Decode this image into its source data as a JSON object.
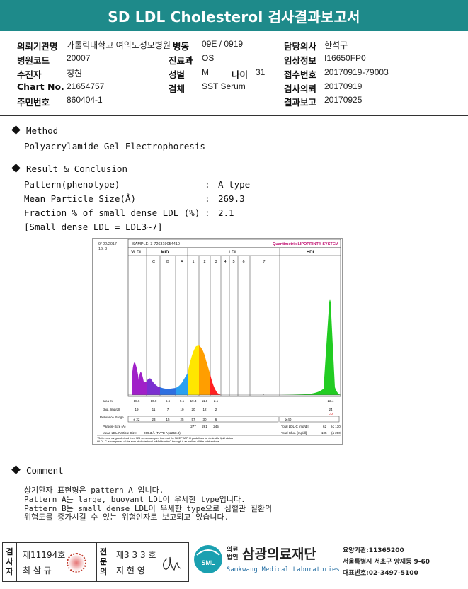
{
  "header": {
    "title": "SD LDL Cholesterol 검사결과보고서"
  },
  "patient_info": {
    "institution_label": "의뢰기관명",
    "institution": "가톨릭대학교 여의도성모병원",
    "ward_label": "병동",
    "ward": "09E / 0919",
    "doctor_label": "담당의사",
    "doctor": "한석구",
    "hospital_code_label": "병원코드",
    "hospital_code": "20007",
    "dept_label": "진료과",
    "dept": "OS",
    "clinical_label": "임상정보",
    "clinical": "I16650FP0",
    "recipient_label": "수진자",
    "recipient": "정현",
    "sex_label": "성별",
    "sex": "M",
    "age_label": "나이",
    "age": "31",
    "receipt_label": "접수번호",
    "receipt": "20170919-79003",
    "chart_label": "Chart No.",
    "chart": "21654757",
    "specimen_label": "검체",
    "specimen": "SST Serum",
    "request_label": "검사의뢰",
    "request": "20170919",
    "rrn_label": "주민번호",
    "rrn": "860404-1",
    "report_label": "결과보고",
    "report": "20170925"
  },
  "method": {
    "heading": "Method",
    "text": "Polyacrylamide Gel Electrophoresis"
  },
  "result": {
    "heading": "Result & Conclusion",
    "pattern_label": "Pattern(phenotype)",
    "pattern_value": "A type",
    "size_label": "Mean Particle Size(Å)",
    "size_value": "269.3",
    "fraction_label": "Fraction % of small dense LDL (%)",
    "fraction_value": "2.1",
    "note": "[Small dense LDL = LDL3~7]",
    "colon": ":"
  },
  "lipoprint": {
    "date": "9/ 22/2017",
    "run": "16: 3",
    "sample": "SAMPLE:   3-726319054410",
    "brand": "Quantimetrix LIPOPRINT® SYSTEM",
    "band_groups": [
      "VLDL",
      "MID",
      "LDL",
      "HDL"
    ],
    "bands": [
      "C",
      "B",
      "A",
      "1",
      "2",
      "3",
      "4",
      "5",
      "6",
      "7"
    ],
    "rows": {
      "area_label": "area %",
      "area": [
        "18.6",
        "10.0",
        "6.6",
        "9.1",
        "19.3",
        "11.8",
        "2.1"
      ],
      "area_hdl": "22.4",
      "chol_label": "chol. [mg/dl]",
      "chol": [
        "19",
        "11",
        "7",
        "10",
        "20",
        "12",
        "2"
      ],
      "chol_hdl": "24",
      "chol_hdl_flag": "LO",
      "ref_label": "Reference Range",
      "ref": [
        "≤ 22",
        "23",
        "15",
        "25",
        "57",
        "30",
        "6"
      ],
      "ref_hdl": "≥ 40",
      "ps_label": "Particle-Size (Å)",
      "ps": [
        "277",
        "261",
        "245"
      ],
      "mean_label": "Mean LDL-Particle Size:",
      "mean_value": "269.3 Å   (TYPE A; ≥268.0)",
      "tl_label": "Total LDL-C [mg/dl]:",
      "tl_value": "62",
      "tl_ref": "(≤ 130)",
      "tc_label": "Total Chol. [mg/dl]:",
      "tc_value": "105",
      "tc_ref": "(≤ 200)",
      "foot1": "*Reference ranges derived from 125 serum samples that met the NCEP ATP III guidelines for desirable lipid status",
      "foot2": "**LDL-C is comprised of the sum of cholesterol in Mid bands C through A as well as all the subfractions"
    },
    "colors": {
      "vldl": "#a020c8",
      "midc": "#7b30d0",
      "midb": "#2e6fe0",
      "mida": "#2aa0f0",
      "ldl1": "#ffe600",
      "ldl2": "#ff9e00",
      "ldl3": "#ff2020",
      "hdl": "#22cc22"
    }
  },
  "comment": {
    "heading": "Comment",
    "lines": [
      "상기환자 표현형은 pattern A 입니다.",
      "Pattern A는 large, buoyant LDL이 우세한 type입니다.",
      "Pattern B는 small dense LDL이 우세한 type으로 심혈관 질환의",
      "위험도를 증가시킬 수 있는 위험인자로 보고되고 있습니다."
    ]
  },
  "signature": {
    "label1": [
      "검",
      "사",
      "자"
    ],
    "no1": "제11194호",
    "name1": "최 삼 규",
    "label2": [
      "전",
      "문",
      "의"
    ],
    "no2": "제3 3 3 호",
    "name2": "지 현 영"
  },
  "org": {
    "prefix": [
      "의료",
      "법인"
    ],
    "name": "삼광의료재단",
    "english": "Samkwang Medical Laboratories",
    "logo_text": "SML",
    "code": "요양기관:11365200",
    "address": "서울특별시 서초구 양재동 9-60",
    "phone": "대표번호:02-3497-5100"
  }
}
